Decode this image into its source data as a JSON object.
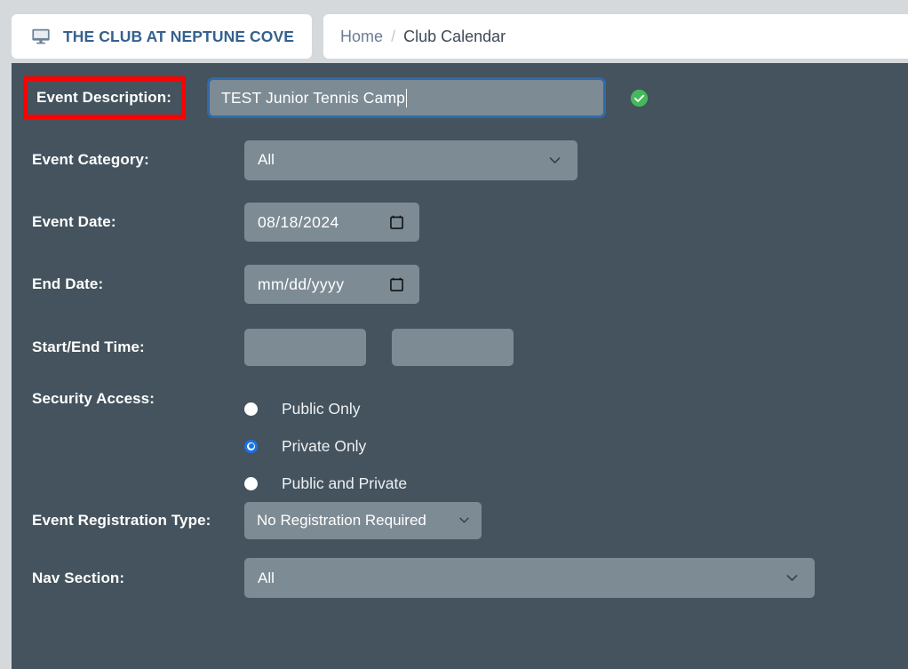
{
  "header": {
    "brand": {
      "icon": "desktop-monitor-icon",
      "title": "THE CLUB AT NEPTUNE COVE",
      "color": "#36618e"
    },
    "breadcrumb": {
      "home": "Home",
      "separator": "/",
      "current": "Club Calendar"
    }
  },
  "form": {
    "panel_color": "#44535d",
    "field_color": "#7d8b94",
    "annotation_color": "#ff0000",
    "focus_border_color": "#2f6aa8",
    "rows": {
      "event_description": {
        "label": "Event Description:",
        "value": "TEST Junior Tennis Camp",
        "placeholder": "",
        "valid_icon": "check-circle-icon",
        "valid_icon_color": "#45b95a",
        "annotated": true
      },
      "event_category": {
        "label": "Event Category:",
        "value": "All",
        "icon": "chevron-down-icon"
      },
      "event_date": {
        "label": "Event Date:",
        "value": "08/18/2024",
        "icon": "calendar-icon"
      },
      "end_date": {
        "label": "End Date:",
        "value": "mm/dd/yyyy",
        "icon": "calendar-icon"
      },
      "start_end_time": {
        "label": "Start/End Time:",
        "start_value": "",
        "end_value": "",
        "start_placeholder": "",
        "end_placeholder": ""
      },
      "security_access": {
        "label": "Security Access:",
        "options": [
          {
            "label": "Public Only",
            "selected": false
          },
          {
            "label": "Private Only",
            "selected": true
          },
          {
            "label": "Public and Private",
            "selected": false
          }
        ],
        "selected_color": "#1a73e8"
      },
      "event_registration_type": {
        "label": "Event Registration Type:",
        "value": "No Registration Required",
        "icon": "chevron-down-icon"
      },
      "nav_section": {
        "label": "Nav Section:",
        "value": "All",
        "icon": "chevron-down-icon"
      }
    }
  }
}
